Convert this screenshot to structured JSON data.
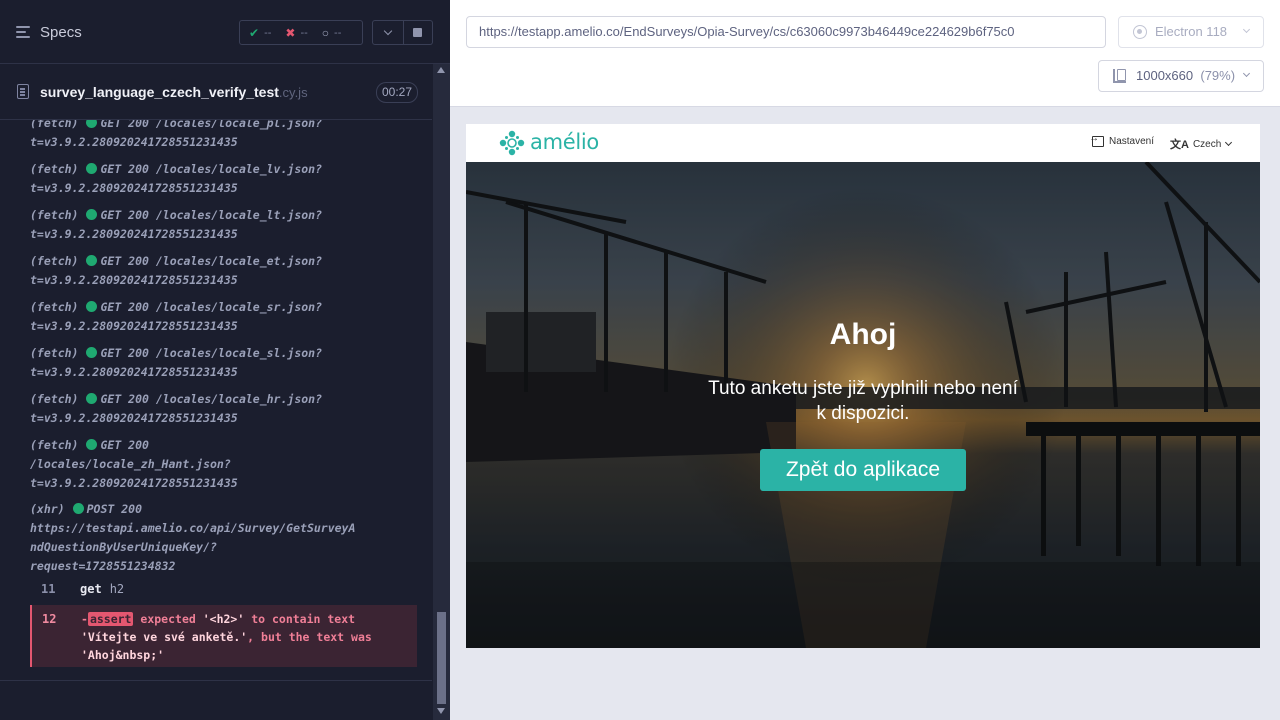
{
  "runner": {
    "specs_label": "Specs",
    "stats": {
      "passed": "--",
      "failed": "--",
      "pending": "--"
    },
    "spec_name": "survey_language_czech_verify_test",
    "spec_ext": ".cy.js",
    "duration": "00:27"
  },
  "log": [
    {
      "type": "(fetch)",
      "line1": "GET 200 /locales/locale_pl.json?",
      "line2": "t=v3.9.2.28092024172855​1231435"
    },
    {
      "type": "(fetch)",
      "line1": "GET 200 /locales/locale_lv.json?",
      "line2": "t=v3.9.2.280920241728551231435"
    },
    {
      "type": "(fetch)",
      "line1": "GET 200 /locales/locale_lt.json?",
      "line2": "t=v3.9.2.280920241728551231435"
    },
    {
      "type": "(fetch)",
      "line1": "GET 200 /locales/locale_et.json?",
      "line2": "t=v3.9.2.280920241728551231435"
    },
    {
      "type": "(fetch)",
      "line1": "GET 200 /locales/locale_sr.json?",
      "line2": "t=v3.9.2.280920241728551231435"
    },
    {
      "type": "(fetch)",
      "line1": "GET 200 /locales/locale_sl.json?",
      "line2": "t=v3.9.2.280920241728551231435"
    },
    {
      "type": "(fetch)",
      "line1": "GET 200 /locales/locale_hr.json?",
      "line2": "t=v3.9.2.280920241728551231435"
    }
  ],
  "log_zh": {
    "type": "(fetch)",
    "line1": "GET 200",
    "line2": "/locales/locale_zh_Hant.json?",
    "line3": "t=v3.9.2.280920241728551231435"
  },
  "log_xhr": {
    "type": "(xhr)",
    "line1": "POST 200",
    "line2": "https://testapi.amelio.co/api/Survey/GetSurveyA",
    "line3": "ndQuestionByUserUniqueKey/?",
    "line4": "request=1728551234832"
  },
  "step11": {
    "num": "11",
    "cmd": "get",
    "arg": "h2"
  },
  "step12": {
    "num": "12",
    "prefix": "-",
    "badge": "assert",
    "text1": " expected ",
    "expected": "'<h2>'",
    "text2": " to contain text",
    "line2a": "'Vítejte ve své anketě.'",
    "line2b": ", but the text was",
    "line3": "'Ahoj&nbsp;'"
  },
  "browser": {
    "url": "https://testapp.amelio.co/EndSurveys/Opia-Survey/cs/c63060c9973b46449ce224629b6f75c0",
    "name": "Electron 118",
    "viewport": "1000x660",
    "zoom": "(79%)"
  },
  "app": {
    "logo": "amélio",
    "settings": "Nastavení",
    "language": "Czech",
    "title": "Ahoj",
    "subtitle": "Tuto anketu jste již vyplnili nebo není k dispozici.",
    "button": "Zpět do aplikace"
  },
  "colors": {
    "accent": "#2bb3a6",
    "runner_bg": "#1b1e2e",
    "error": "#e45770",
    "success": "#1fa971"
  }
}
